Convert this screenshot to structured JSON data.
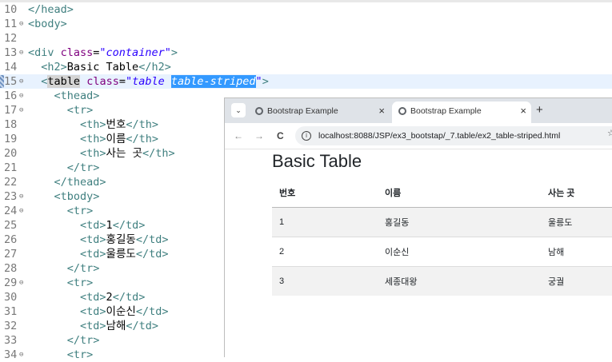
{
  "editor": {
    "lines": [
      {
        "n": "10",
        "fold": "",
        "parts": [
          [
            "tag",
            "</head>"
          ]
        ]
      },
      {
        "n": "11",
        "fold": "⊖",
        "parts": [
          [
            "tag",
            "<body>"
          ]
        ]
      },
      {
        "n": "12",
        "fold": "",
        "parts": []
      },
      {
        "n": "13",
        "fold": "⊖",
        "parts": [
          [
            "tag",
            "<div "
          ],
          [
            "attr",
            "class"
          ],
          [
            "txt",
            "="
          ],
          [
            "str",
            "\"container\""
          ],
          [
            "tag",
            ">"
          ]
        ]
      },
      {
        "n": "14",
        "fold": "",
        "parts": [
          [
            "txt",
            "  "
          ],
          [
            "tag",
            "<h2>"
          ],
          [
            "txt",
            "Basic Table"
          ],
          [
            "tag",
            "</h2>"
          ]
        ]
      },
      {
        "n": "15",
        "fold": "⊖",
        "parts": [
          [
            "txt",
            "  "
          ],
          [
            "tag",
            "<"
          ],
          [
            "match",
            "table"
          ],
          [
            "txt",
            " "
          ],
          [
            "attr",
            "class"
          ],
          [
            "txt",
            "="
          ],
          [
            "str",
            "\"table "
          ],
          [
            "sel",
            "table-striped"
          ],
          [
            "str",
            "\""
          ],
          [
            "tag",
            ">"
          ]
        ]
      },
      {
        "n": "16",
        "fold": "⊖",
        "parts": [
          [
            "txt",
            "    "
          ],
          [
            "tag",
            "<thead>"
          ]
        ]
      },
      {
        "n": "17",
        "fold": "⊖",
        "parts": [
          [
            "txt",
            "      "
          ],
          [
            "tag",
            "<tr>"
          ]
        ]
      },
      {
        "n": "18",
        "fold": "",
        "parts": [
          [
            "txt",
            "        "
          ],
          [
            "tag",
            "<th>"
          ],
          [
            "txt",
            "번호"
          ],
          [
            "tag",
            "</th>"
          ]
        ]
      },
      {
        "n": "19",
        "fold": "",
        "parts": [
          [
            "txt",
            "        "
          ],
          [
            "tag",
            "<th>"
          ],
          [
            "txt",
            "이름"
          ],
          [
            "tag",
            "</th>"
          ]
        ]
      },
      {
        "n": "20",
        "fold": "",
        "parts": [
          [
            "txt",
            "        "
          ],
          [
            "tag",
            "<th>"
          ],
          [
            "txt",
            "사는 곳"
          ],
          [
            "tag",
            "</th>"
          ]
        ]
      },
      {
        "n": "21",
        "fold": "",
        "parts": [
          [
            "txt",
            "      "
          ],
          [
            "tag",
            "</tr>"
          ]
        ]
      },
      {
        "n": "22",
        "fold": "",
        "parts": [
          [
            "txt",
            "    "
          ],
          [
            "tag",
            "</thead>"
          ]
        ]
      },
      {
        "n": "23",
        "fold": "⊖",
        "parts": [
          [
            "txt",
            "    "
          ],
          [
            "tag",
            "<tbody>"
          ]
        ]
      },
      {
        "n": "24",
        "fold": "⊖",
        "parts": [
          [
            "txt",
            "      "
          ],
          [
            "tag",
            "<tr>"
          ]
        ]
      },
      {
        "n": "25",
        "fold": "",
        "parts": [
          [
            "txt",
            "        "
          ],
          [
            "tag",
            "<td>"
          ],
          [
            "txt",
            "1"
          ],
          [
            "tag",
            "</td>"
          ]
        ]
      },
      {
        "n": "26",
        "fold": "",
        "parts": [
          [
            "txt",
            "        "
          ],
          [
            "tag",
            "<td>"
          ],
          [
            "txt",
            "홍길동"
          ],
          [
            "tag",
            "</td>"
          ]
        ]
      },
      {
        "n": "27",
        "fold": "",
        "parts": [
          [
            "txt",
            "        "
          ],
          [
            "tag",
            "<td>"
          ],
          [
            "txt",
            "울릉도"
          ],
          [
            "tag",
            "</td>"
          ]
        ]
      },
      {
        "n": "28",
        "fold": "",
        "parts": [
          [
            "txt",
            "      "
          ],
          [
            "tag",
            "</tr>"
          ]
        ]
      },
      {
        "n": "29",
        "fold": "⊖",
        "parts": [
          [
            "txt",
            "      "
          ],
          [
            "tag",
            "<tr>"
          ]
        ]
      },
      {
        "n": "30",
        "fold": "",
        "parts": [
          [
            "txt",
            "        "
          ],
          [
            "tag",
            "<td>"
          ],
          [
            "txt",
            "2"
          ],
          [
            "tag",
            "</td>"
          ]
        ]
      },
      {
        "n": "31",
        "fold": "",
        "parts": [
          [
            "txt",
            "        "
          ],
          [
            "tag",
            "<td>"
          ],
          [
            "txt",
            "이순신"
          ],
          [
            "tag",
            "</td>"
          ]
        ]
      },
      {
        "n": "32",
        "fold": "",
        "parts": [
          [
            "txt",
            "        "
          ],
          [
            "tag",
            "<td>"
          ],
          [
            "txt",
            "남해"
          ],
          [
            "tag",
            "</td>"
          ]
        ]
      },
      {
        "n": "33",
        "fold": "",
        "parts": [
          [
            "txt",
            "      "
          ],
          [
            "tag",
            "</tr>"
          ]
        ]
      },
      {
        "n": "34",
        "fold": "⊖",
        "parts": [
          [
            "txt",
            "      "
          ],
          [
            "tag",
            "<tr>"
          ]
        ]
      }
    ]
  },
  "browser": {
    "tabs_menu": "⌄",
    "tabs": [
      {
        "title": "Bootstrap Example",
        "close": "×"
      },
      {
        "title": "Bootstrap Example",
        "close": "×"
      }
    ],
    "new_tab": "+",
    "back": "←",
    "forward": "→",
    "reload": "C",
    "info_icon": "i",
    "url": "localhost:8088/JSP/ex3_bootstap/_7.table/ex2_table-striped.html",
    "star": "☆"
  },
  "page": {
    "heading": "Basic Table",
    "table": {
      "headers": [
        "번호",
        "이름",
        "사는 곳"
      ],
      "rows": [
        [
          "1",
          "홍길동",
          "울릉도"
        ],
        [
          "2",
          "이순신",
          "남해"
        ],
        [
          "3",
          "세종대왕",
          "궁궐"
        ]
      ]
    }
  }
}
